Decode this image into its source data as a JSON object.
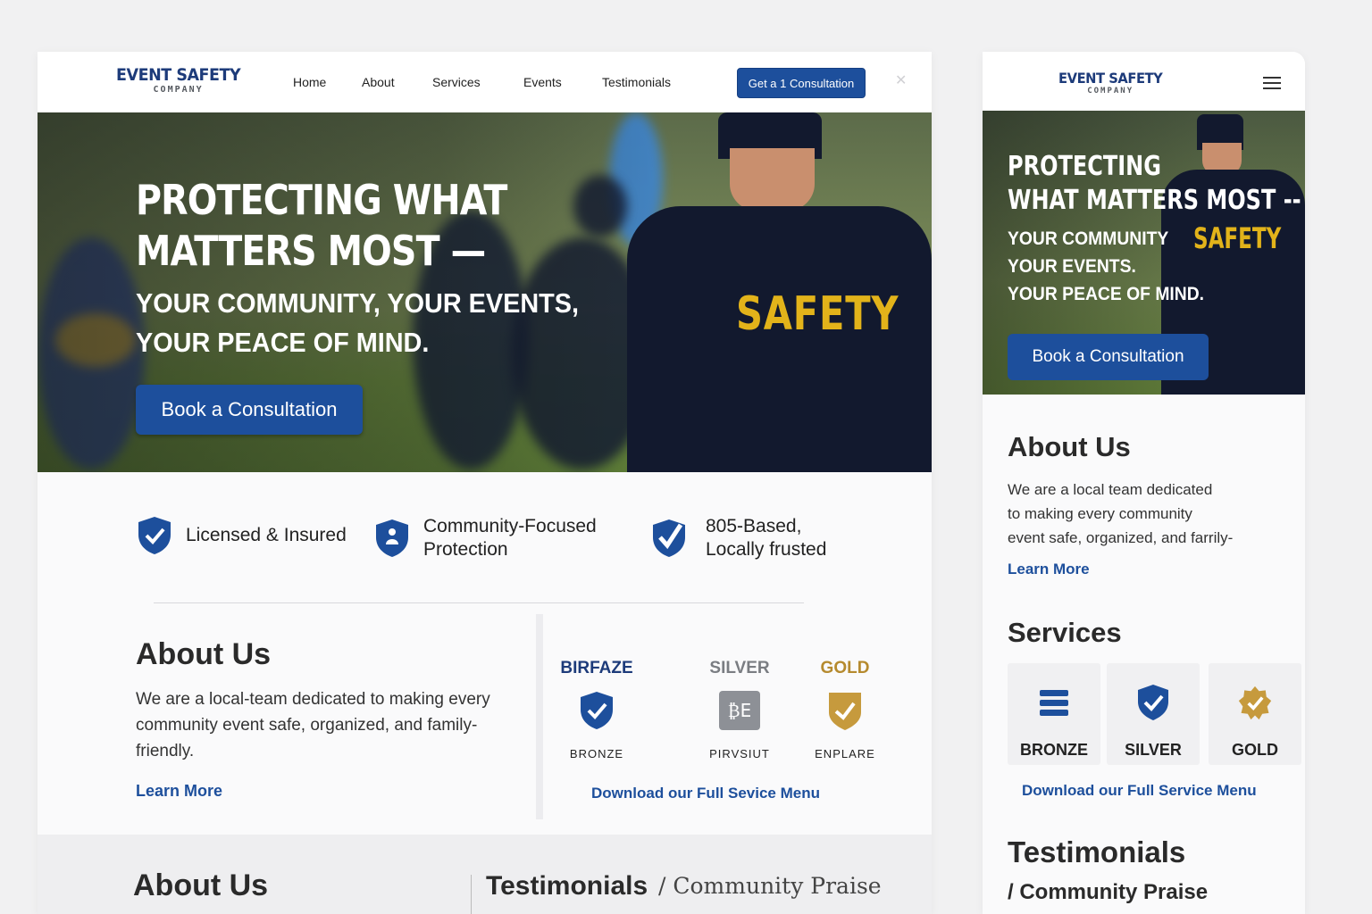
{
  "brand": {
    "name": "EVENT SAFETY",
    "sub": "COMPANY"
  },
  "desktop": {
    "nav": [
      "Home",
      "About",
      "Services",
      "Events",
      "Testimonials"
    ],
    "cta_label": "Get a 1 Consultation",
    "hero": {
      "title_line1": "PROTECTING WHAT",
      "title_line2": "MATTERS MOST —",
      "sub_line1": "YOUR COMMUNITY, YOUR EVENTS,",
      "sub_line2": "YOUR PEACE OF MIND.",
      "button": "Book a Consultation",
      "shirt_text": "SAFETY"
    },
    "trust": [
      {
        "line1": "Licensed & Insured",
        "line2": "",
        "icon": "shield-check-icon"
      },
      {
        "line1": "Community-Focused",
        "line2": "Protection",
        "icon": "shield-person-icon"
      },
      {
        "line1": "805-Based,",
        "line2": "Locally frusted",
        "icon": "checkmark-badge-icon"
      }
    ],
    "about": {
      "title": "About Us",
      "body": "We are a local-team dedicated to making every community event safe, organized, and family-friendly.",
      "link": "Learn More"
    },
    "tiers": [
      {
        "name": "BIRFAZE",
        "sub": "BRONZE",
        "color": "#1d3b7a",
        "icon": "shield-check-icon"
      },
      {
        "name": "SILVER",
        "sub": "PIRVSIUT",
        "color": "#7a7d82",
        "icon": "badge-silver-icon"
      },
      {
        "name": "GOLD",
        "sub": "ENPLARE",
        "color": "#b58a2e",
        "icon": "shield-gold-icon"
      }
    ],
    "download_link": "Download our Full Sevice Menu",
    "bottom": {
      "about": "About Us",
      "testimonials": "Testimonials",
      "praise": "/ Community Praise"
    }
  },
  "mobile": {
    "hero": {
      "title_line1": "PROTECTING",
      "title_line2": "WHAT MATTERS MOST --",
      "sub_line1": "YOUR COMMUNITY",
      "sub_line2": "YOUR EVENTS.",
      "sub_line3": "YOUR PEACE OF MIND.",
      "shirt_text": "SAFETY",
      "button": "Book a Consultation"
    },
    "about": {
      "title": "About Us",
      "body_line1": "We are a local team dedicated",
      "body_line2": "to making every community",
      "body_line3": "event safe, organized, and farrily-",
      "link": "Learn More"
    },
    "services_title": "Services",
    "cards": [
      {
        "label": "BRONZE",
        "icon": "menu-bars-icon"
      },
      {
        "label": "SILVER",
        "icon": "shield-check-icon"
      },
      {
        "label": "GOLD",
        "icon": "badge-gold-icon"
      }
    ],
    "download_link": "Download our Full Service Menu",
    "testimonials": "Testimonials",
    "praise": "/ Community Praise"
  },
  "colors": {
    "primary": "#1d4f9c",
    "navy": "#1d3b7a",
    "gold": "#e2b31a",
    "shirt": "#12192e"
  }
}
